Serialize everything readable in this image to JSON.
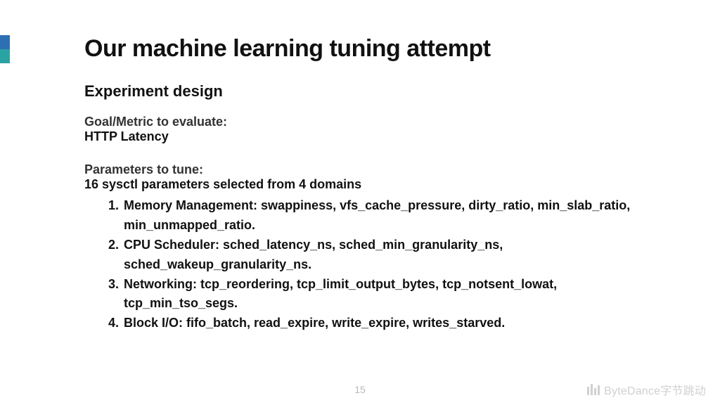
{
  "title": "Our machine learning tuning attempt",
  "subtitle": "Experiment design",
  "goal_label": "Goal/Metric to evaluate:",
  "goal_value": "HTTP Latency",
  "params_label": "Parameters to tune:",
  "params_summary": "16 sysctl parameters selected from 4 domains",
  "domains": [
    {
      "name": "Memory Management",
      "params": "swappiness, vfs_cache_pressure, dirty_ratio, min_slab_ratio, min_unmapped_ratio."
    },
    {
      "name": "CPU Scheduler",
      "params": "sched_latency_ns, sched_min_granularity_ns, sched_wakeup_granularity_ns."
    },
    {
      "name": "Networking",
      "params": "tcp_reordering, tcp_limit_output_bytes, tcp_notsent_lowat, tcp_min_tso_segs."
    },
    {
      "name": "Block I/O",
      "params": "fifo_batch, read_expire, write_expire, writes_starved."
    }
  ],
  "page_number": "15",
  "brand": "ByteDance字节跳动"
}
